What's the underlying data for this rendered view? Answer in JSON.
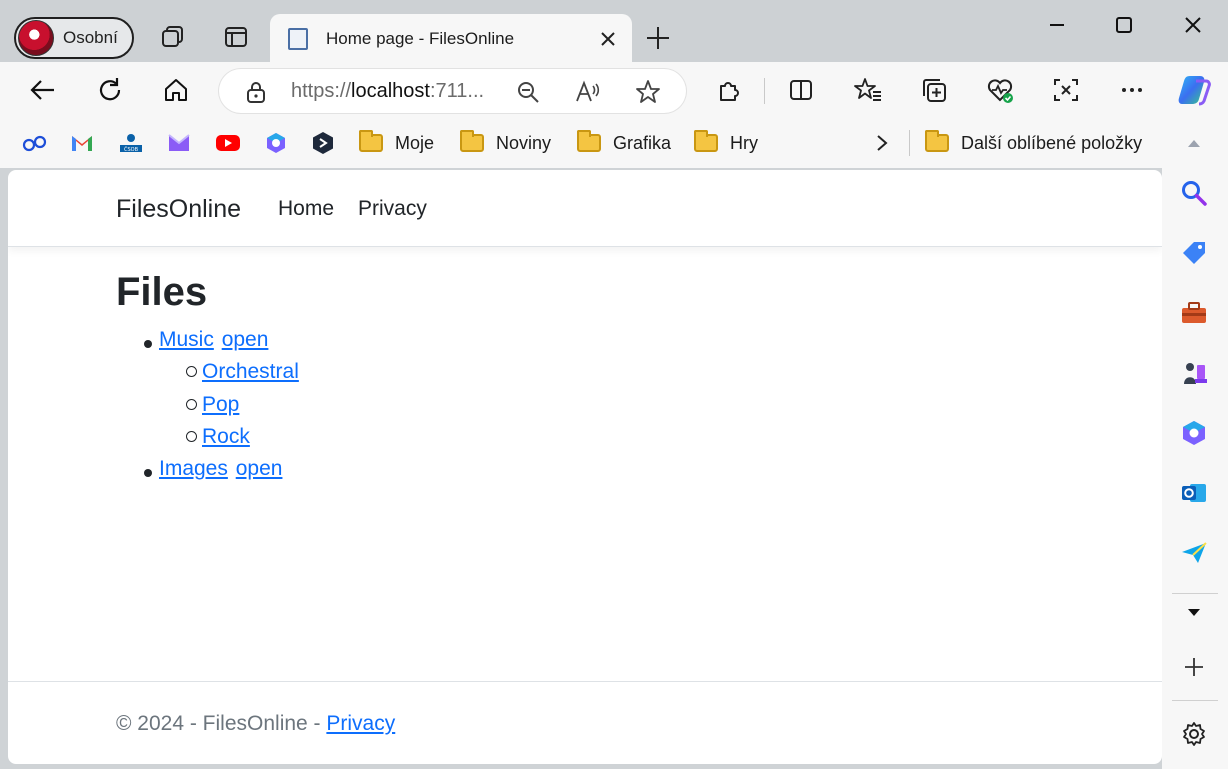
{
  "browser": {
    "profile_label": "Osobní",
    "tab_title": "Home page - FilesOnline",
    "url_prefix": "https://",
    "url_host": "localhost",
    "url_suffix": ":711...",
    "favorites": [
      {
        "label": "Moje"
      },
      {
        "label": "Noviny"
      },
      {
        "label": "Grafika"
      },
      {
        "label": "Hry"
      }
    ],
    "other_favorites_label": "Další oblíbené položky",
    "icons": {
      "back": "arrow-left-icon",
      "refresh": "refresh-icon",
      "home": "home-icon",
      "lock": "lock-icon",
      "zoom": "zoom-out-icon",
      "read_aloud": "read-aloud-icon",
      "favorite": "star-icon"
    },
    "accent": "#0d6efd"
  },
  "site": {
    "brand": "FilesOnline",
    "nav": {
      "home": "Home",
      "privacy": "Privacy"
    },
    "heading": "Files",
    "tree": {
      "music": "Music",
      "music_open": "open",
      "children": [
        "Orchestral",
        "Pop",
        "Rock"
      ],
      "images": "Images",
      "images_open": "open"
    },
    "footer": {
      "text": "© 2024 - FilesOnline - ",
      "link": "Privacy"
    }
  }
}
